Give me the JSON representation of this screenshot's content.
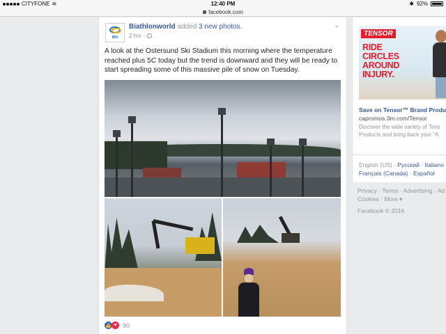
{
  "status_bar": {
    "carrier": "CITYFONE",
    "time": "12:40 PM",
    "battery": "92%"
  },
  "url_bar": {
    "url": "facebook.com"
  },
  "post": {
    "author": "Biathlonworld",
    "action_text": " added ",
    "photos_link": "3 new photos.",
    "time": "2 hrs",
    "time_separator": "·",
    "avatar_text": "IBU",
    "caption": "A look at the Ostersund Ski Stadium this morning where the temperature reached plus 5C today but the trend is downward and they will be ready to start spreading some of this massive pile of snow on Tuesday.",
    "reaction_count": "90",
    "icons": [
      "globe-icon",
      "chevron-down-icon",
      "like-reaction-icon",
      "love-reaction-icon"
    ]
  },
  "ad": {
    "brand_logo": "TENSOR",
    "headline_lines": [
      "RIDE",
      "CIRCLES",
      "AROUND",
      "INJURY."
    ],
    "title": "Save on Tensor™ Brand Produ",
    "domain": "capromos.3m.com/Tensor",
    "desc_line1": "Discover the wide variety of Tens",
    "desc_line2": "Products and bring back your \"A",
    "brand_color": "#e11f2c"
  },
  "languages": {
    "current": "English (US)",
    "options": [
      "Русский",
      "Italiano",
      "Français (Canada)",
      "Español"
    ],
    "separator": "·"
  },
  "footer": {
    "links": [
      "Privacy",
      "Terms",
      "Advertising",
      "Ad"
    ],
    "separator": "·",
    "cookies": "Cookies",
    "more": "More ▾",
    "copyright": "Facebook © 2016"
  },
  "colors": {
    "link": "#365899",
    "background": "#e9ebee",
    "muted": "#90949c"
  }
}
